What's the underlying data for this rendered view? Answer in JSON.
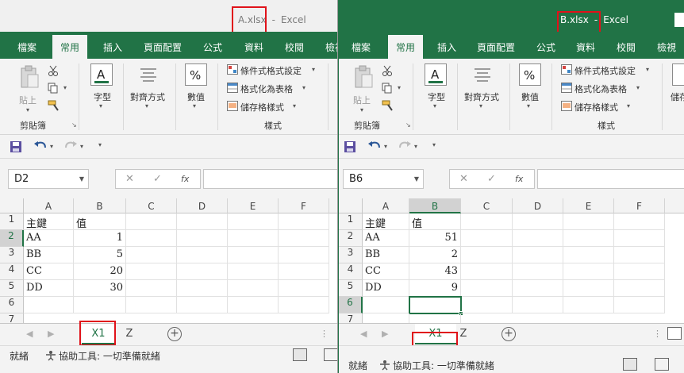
{
  "windows": {
    "a": {
      "file": "A.xlsx",
      "app": "Excel",
      "sep": "-",
      "tabs": [
        "檔案",
        "常用",
        "插入",
        "頁面配置",
        "公式",
        "資料",
        "校閱",
        "檢視"
      ],
      "name_box": "D2",
      "cols": [
        "A",
        "B",
        "C",
        "D",
        "E",
        "F"
      ],
      "rows": [
        "1",
        "2",
        "3",
        "4",
        "5",
        "6",
        "7"
      ],
      "cells": [
        [
          "主鍵",
          "值"
        ],
        [
          "AA",
          "1"
        ],
        [
          "BB",
          "5"
        ],
        [
          "CC",
          "20"
        ],
        [
          "DD",
          "30"
        ]
      ],
      "sheets": [
        "X1",
        "Z"
      ]
    },
    "b": {
      "file": "B.xlsx",
      "app": "Excel",
      "sep": "-",
      "tabs": [
        "檔案",
        "常用",
        "插入",
        "頁面配置",
        "公式",
        "資料",
        "校閱",
        "檢視"
      ],
      "name_box": "B6",
      "cols": [
        "A",
        "B",
        "C",
        "D",
        "E",
        "F"
      ],
      "rows": [
        "1",
        "2",
        "3",
        "4",
        "5",
        "6",
        "7"
      ],
      "cells": [
        [
          "主鍵",
          "值"
        ],
        [
          "AA",
          "51"
        ],
        [
          "BB",
          "2"
        ],
        [
          "CC",
          "43"
        ],
        [
          "DD",
          "9"
        ]
      ],
      "sheets": [
        "X1",
        "Z"
      ]
    }
  },
  "ribbon": {
    "paste": "貼上",
    "clipboard": "剪貼簿",
    "font": "字型",
    "alignment": "對齊方式",
    "number": "數值",
    "conditional": "條件式格式設定",
    "format_table": "格式化為表格",
    "cell_styles": "儲存格樣式",
    "styles": "樣式",
    "cells_partial": "儲存"
  },
  "formula": {
    "cancel": "✕",
    "enter": "✓",
    "fx": "fx"
  },
  "qat": {
    "save_icon": "save-icon",
    "undo_icon": "undo-icon",
    "redo_icon": "redo-icon"
  },
  "status": {
    "ready": "就緒",
    "accessibility": "協助工具: 一切準備就緒"
  },
  "colors": {
    "excel_green": "#217346",
    "highlight_red": "#e0121a"
  }
}
